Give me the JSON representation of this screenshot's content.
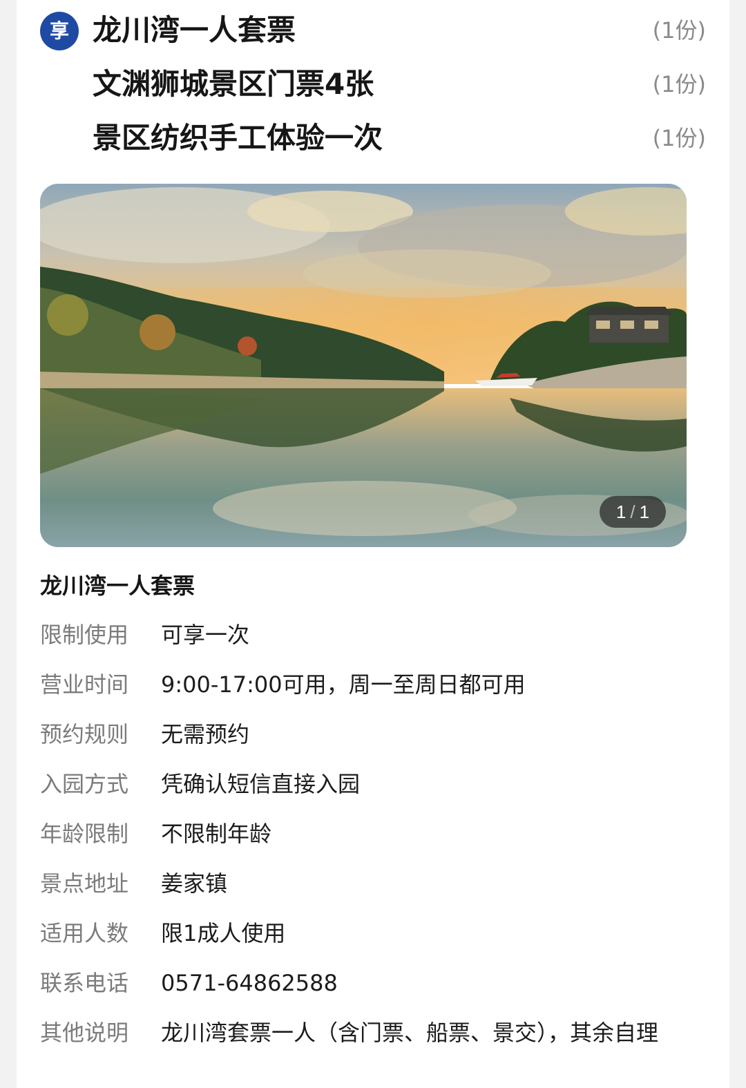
{
  "package": {
    "badge": "享",
    "items": [
      {
        "name": "龙川湾一人套票",
        "qty": "(1份)"
      },
      {
        "name": "文渊狮城景区门票4张",
        "qty": "(1份)"
      },
      {
        "name": "景区纺织手工体验一次",
        "qty": "(1份)"
      }
    ]
  },
  "gallery": {
    "current": "1",
    "separator": "/",
    "total": "1",
    "image": "lake-sunset-photo"
  },
  "details": {
    "title": "龙川湾一人套票",
    "rows": [
      {
        "label": "限制使用",
        "value": "可享一次"
      },
      {
        "label": "营业时间",
        "value": "9:00-17:00可用，周一至周日都可用"
      },
      {
        "label": "预约规则",
        "value": "无需预约"
      },
      {
        "label": "入园方式",
        "value": "凭确认短信直接入园"
      },
      {
        "label": "年龄限制",
        "value": "不限制年龄"
      },
      {
        "label": "景点地址",
        "value": "姜家镇"
      },
      {
        "label": "适用人数",
        "value": "限1成人使用"
      },
      {
        "label": "联系电话",
        "value": "0571-64862588"
      },
      {
        "label": "其他说明",
        "value": "龙川湾套票一人（含门票、船票、景交），其余自理"
      }
    ]
  },
  "colors": {
    "badge": "#1f4aa3",
    "label": "#7b7b7b",
    "text": "#1c1c1c",
    "qty": "#8a8a8a"
  }
}
